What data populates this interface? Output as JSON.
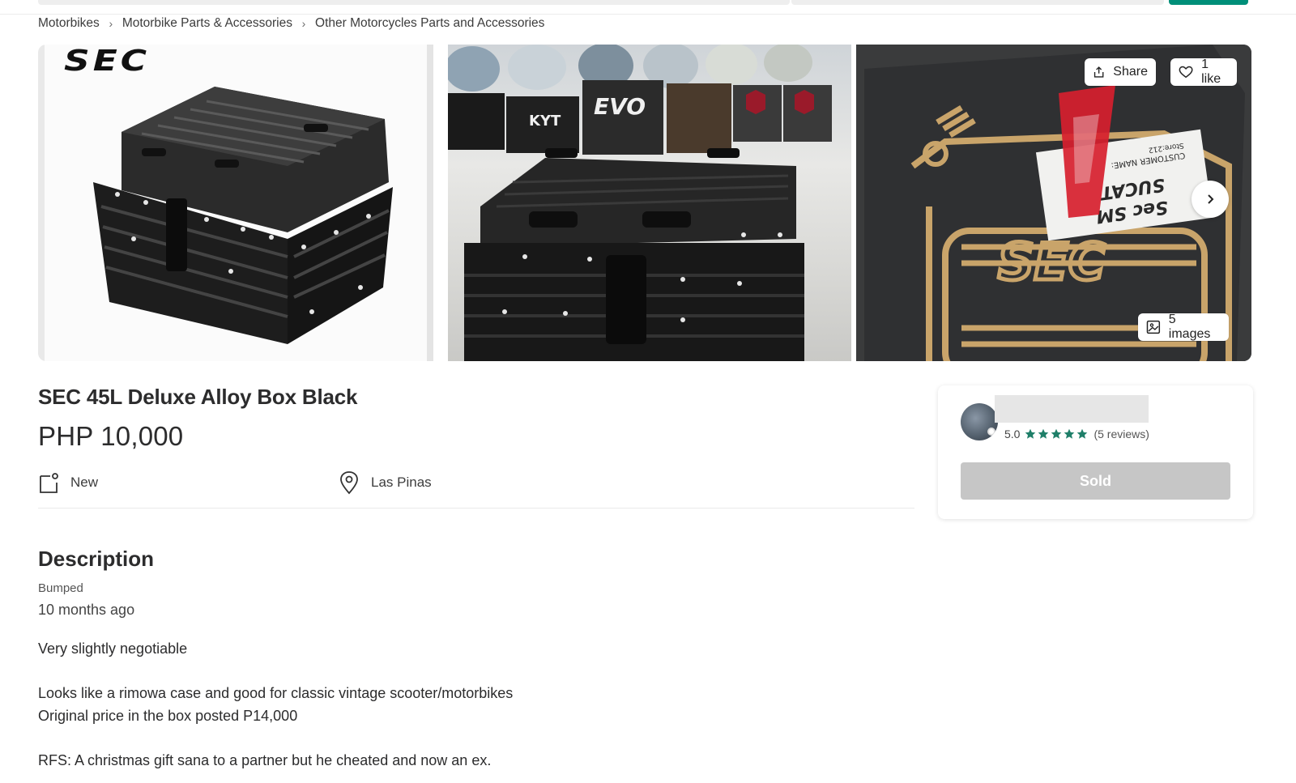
{
  "breadcrumb": {
    "items": [
      "Motorbikes",
      "Motorbike Parts & Accessories",
      "Other Motorcycles Parts and Accessories"
    ]
  },
  "gallery": {
    "logo_text": "SEC",
    "share_label": "Share",
    "like_label": "1 like",
    "images_label": "5 images",
    "tile2_signs": [
      "EVO",
      "KYT"
    ],
    "box_label_lines": [
      "Sec SM",
      "SUCAT",
      "CUSTOMER NAME:",
      "Store:212"
    ]
  },
  "listing": {
    "title": "SEC 45L Deluxe Alloy Box Black",
    "price": "PHP 10,000",
    "condition": "New",
    "location": "Las Pinas"
  },
  "description": {
    "heading": "Description",
    "bumped_label": "Bumped",
    "bumped_time": "10 months ago",
    "lines": [
      "Very slightly negotiable",
      "",
      "Looks like a rimowa case and good for classic vintage scooter/motorbikes",
      "Original price in the box posted P14,000",
      "",
      "RFS: A christmas gift sana to a partner but he cheated and now an ex."
    ]
  },
  "seller": {
    "rating": "5.0",
    "stars": 5,
    "reviews": "(5 reviews)",
    "sold_label": "Sold"
  },
  "colors": {
    "accent_green": "#008f79",
    "star_green": "#1f7f69",
    "sold_grey": "#c6c6c6"
  }
}
